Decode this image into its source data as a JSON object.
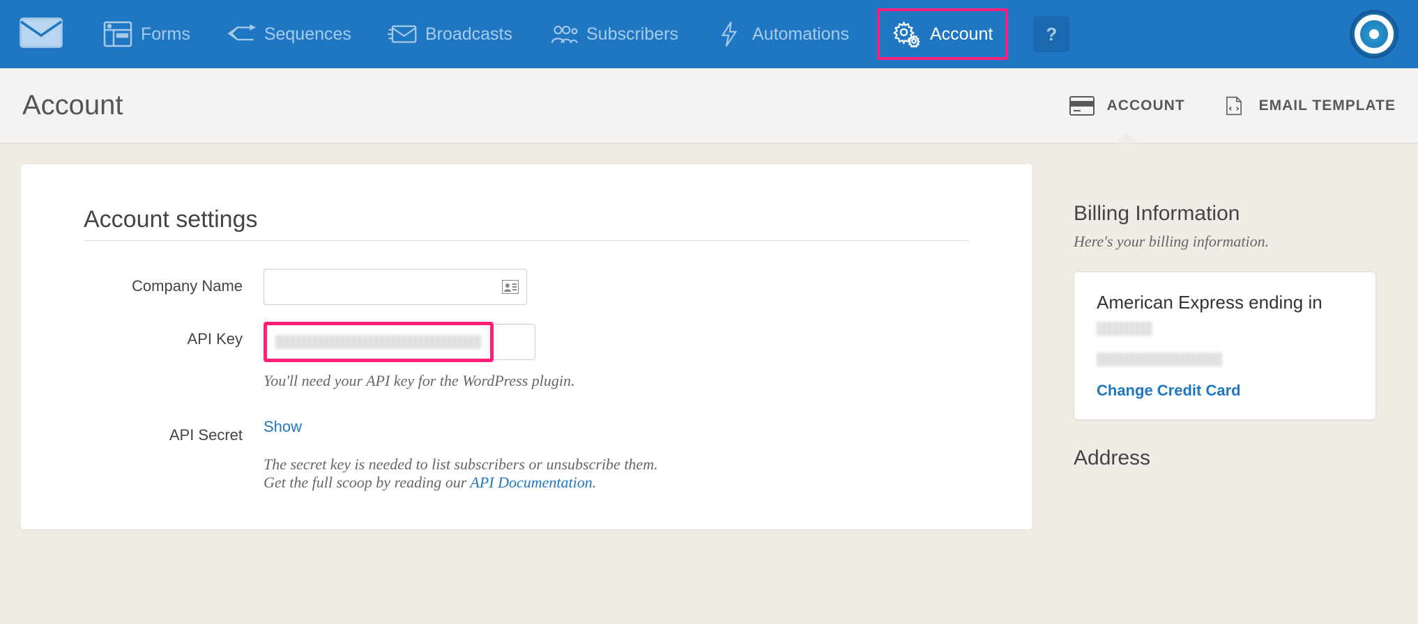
{
  "nav": {
    "items": [
      {
        "label": "Forms"
      },
      {
        "label": "Sequences"
      },
      {
        "label": "Broadcasts"
      },
      {
        "label": "Subscribers"
      },
      {
        "label": "Automations"
      },
      {
        "label": "Account"
      }
    ],
    "help": "?"
  },
  "page": {
    "title": "Account",
    "tabs": [
      {
        "label": "ACCOUNT"
      },
      {
        "label": "EMAIL TEMPLATE"
      }
    ]
  },
  "settings": {
    "title": "Account settings",
    "company_label": "Company Name",
    "company_value": "",
    "api_key_label": "API Key",
    "api_key_help": "You'll need your API key for the WordPress plugin.",
    "api_secret_label": "API Secret",
    "api_secret_show": "Show",
    "api_secret_help_1": "The secret key is needed to list subscribers or unsubscribe them.",
    "api_secret_help_2a": "Get the full scoop by reading our ",
    "api_secret_help_2b": "API Documentation",
    "api_secret_help_2c": "."
  },
  "billing": {
    "title": "Billing Information",
    "subtitle": "Here's your billing information.",
    "card_title": "American Express ending in",
    "change_card": "Change Credit Card",
    "address_title": "Address"
  }
}
